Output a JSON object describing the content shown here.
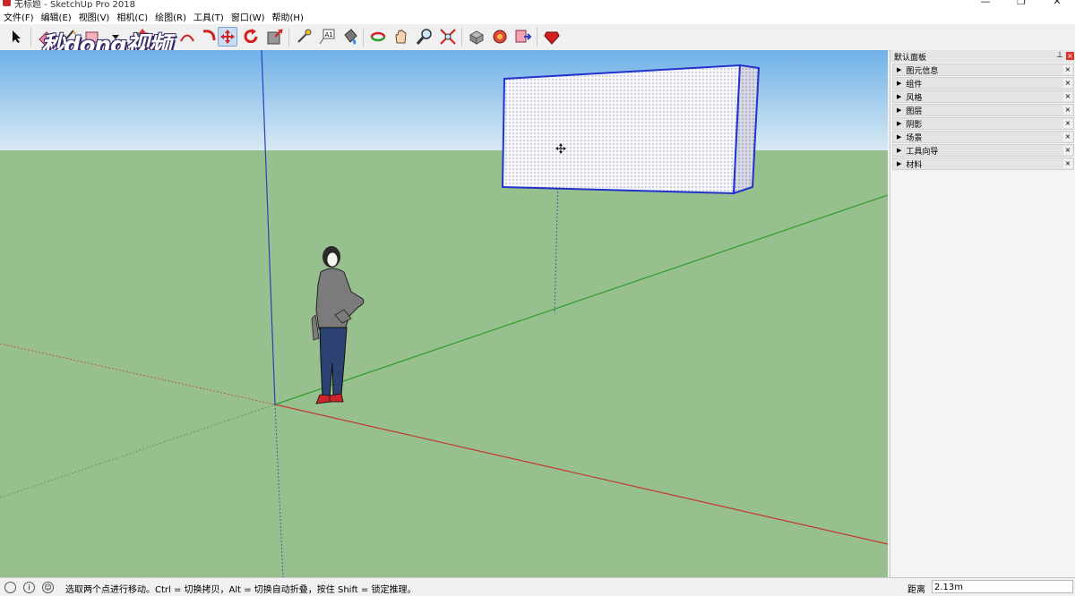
{
  "window": {
    "title": "无标题 - SketchUp Pro 2018",
    "minimize_glyph": "—",
    "maximize_glyph": "❐",
    "close_glyph": "✕"
  },
  "menu": [
    "文件(F)",
    "编辑(E)",
    "视图(V)",
    "相机(C)",
    "绘图(R)",
    "工具(T)",
    "窗口(W)",
    "帮助(H)"
  ],
  "watermark": {
    "text": "秒dong视频"
  },
  "toolbar": {
    "icons": [
      "select-arrow-icon",
      "eraser-icon",
      "line-tool-icon",
      "rectangle-tool-icon",
      "push-pull-icon",
      "move-icon",
      "rotate-icon",
      "scale-icon",
      "tape-measure-icon",
      "text-tool-icon",
      "paint-bucket-icon",
      "orbit-icon",
      "pan-icon",
      "zoom-icon",
      "zoom-extents-icon",
      "3d-warehouse-icon",
      "extension-warehouse-icon",
      "send-to-layout-icon",
      "extension-manager-icon"
    ],
    "active_tool": "move-icon"
  },
  "panel": {
    "title": "默认面板",
    "pin_glyph": "⊥",
    "close_glyph": "×",
    "trays": [
      {
        "label": "图元信息"
      },
      {
        "label": "组件"
      },
      {
        "label": "风格"
      },
      {
        "label": "图层"
      },
      {
        "label": "阴影"
      },
      {
        "label": "场景"
      },
      {
        "label": "工具向导"
      },
      {
        "label": "材料"
      }
    ],
    "tray_arrow": "▶",
    "tray_close": "×"
  },
  "status": {
    "message": "选取两个点进行移动。Ctrl = 切换拷贝，Alt = 切换自动折叠，按住 Shift = 锁定推理。",
    "measure_label": "距离",
    "measure_value": "2.13m",
    "icon_info": "i",
    "icon_user": "☺"
  },
  "colors": {
    "sky_top": "#6fb1e8",
    "sky_bottom": "#d8e9f3",
    "ground": "#98c08f",
    "red_axis": "#c0392b",
    "green_axis": "#2e9d2e",
    "blue_axis": "#2c3fb8",
    "selection": "#2233cc"
  }
}
